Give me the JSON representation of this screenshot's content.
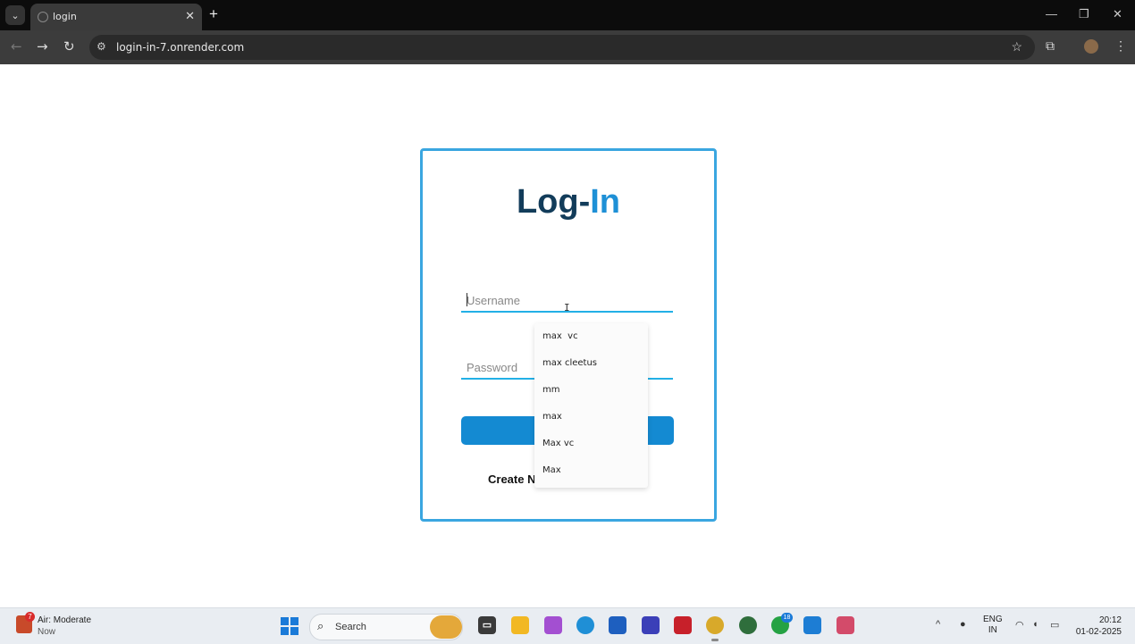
{
  "browser": {
    "tab_title": "login",
    "url": "login-in-7.onrender.com",
    "new_tab_icon": "plus-icon",
    "close_tab_icon": "close-icon"
  },
  "page": {
    "heading_part1": "Log-",
    "heading_part2": "In",
    "username_placeholder": "Username",
    "password_placeholder": "Password",
    "create_link": "Create N",
    "accent_color": "#1e90d6",
    "border_color": "#3aa6e0"
  },
  "autocomplete": {
    "items": [
      "max  vc",
      "max cleetus",
      "mm",
      "max",
      "Max vc",
      "Max"
    ]
  },
  "taskbar": {
    "weather_badge": "7",
    "weather_title": "Air: Moderate",
    "weather_sub": "Now",
    "search_label": "Search",
    "whatsapp_badge": "18",
    "lang_line1": "ENG",
    "lang_line2": "IN",
    "time": "20:12",
    "date": "01-02-2025"
  }
}
